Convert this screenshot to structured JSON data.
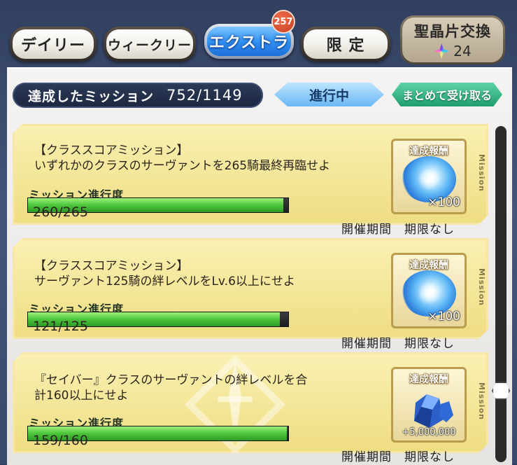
{
  "tabs": [
    {
      "label": "デイリー"
    },
    {
      "label": "ウィークリー"
    },
    {
      "label": "エクストラ",
      "badge": "257"
    },
    {
      "label": "限 定"
    }
  ],
  "exchange": {
    "label": "聖晶片交換",
    "count": "24"
  },
  "summary": {
    "label": "達成したミッション",
    "value": "752/1149"
  },
  "filter": {
    "label": "進行中"
  },
  "receive_all": {
    "label": "まとめて受け取る"
  },
  "mission_tag": "Mission",
  "missions": [
    {
      "text": "【クラススコアミッション】\nいずれかのクラスのサーヴァントを265騎最終再臨せよ",
      "progress_label": "ミッション進行度",
      "progress_text": "260/265",
      "progress_fraction": 0.981,
      "reward_title": "達成報酬",
      "reward_qty": "×100",
      "reward_icon": "saint-quartz-fragment-icon",
      "period": "開催期間　期限なし"
    },
    {
      "text": "【クラススコアミッション】\nサーヴァント125騎の絆レベルをLv.6以上にせよ",
      "progress_label": "ミッション進行度",
      "progress_text": "121/125",
      "progress_fraction": 0.968,
      "reward_title": "達成報酬",
      "reward_qty": "×100",
      "reward_icon": "saint-quartz-fragment-icon",
      "period": "開催期間　期限なし"
    },
    {
      "text": "『セイバー』クラスのサーヴァントの絆レベルを合\n計160以上にせよ",
      "progress_label": "ミッション進行度",
      "progress_text": "159/160",
      "progress_fraction": 0.994,
      "reward_title": "達成報酬",
      "reward_qty": "+5,000,000",
      "reward_icon": "qp-crystal-icon",
      "period": "開催期間　期限なし"
    }
  ]
}
